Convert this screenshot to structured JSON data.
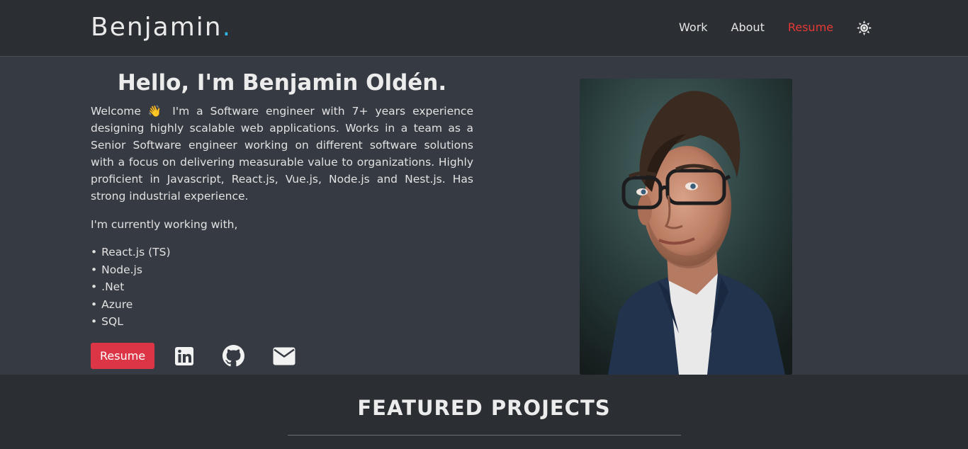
{
  "header": {
    "brand": "Benjamin",
    "brand_dot": ".",
    "nav": [
      {
        "label": "Work"
      },
      {
        "label": "About"
      },
      {
        "label": "Resume"
      }
    ],
    "theme_icon": "sun-icon"
  },
  "hero": {
    "greeting": "Hello, I'm Benjamin Oldén.",
    "intro": "Welcome 👋 I'm a Software engineer with 7+ years experience designing highly scalable web applications. Works in a team as a Senior Software engineer working on different software solutions with a focus on delivering measurable value to organizations. Highly proficient in Javascript, React.js, Vue.js, Node.js and Nest.js. Has strong industrial experience.",
    "working_with": "I'm currently working with,",
    "skills": [
      "React.js (TS)",
      "Node.js",
      ".Net",
      "Azure",
      "SQL"
    ],
    "resume_button": "Resume",
    "social_icons": [
      "linkedin-icon",
      "github-icon",
      "envelope-icon"
    ],
    "photo": "profile-photo"
  },
  "featured": {
    "title": "FEATURED PROJECTS"
  },
  "colors": {
    "accent_red": "#dc3545",
    "nav_active": "#e53935",
    "brand_dot": "#33b5e5",
    "header_bg": "#2b2e33",
    "hero_bg": "#363a42"
  }
}
